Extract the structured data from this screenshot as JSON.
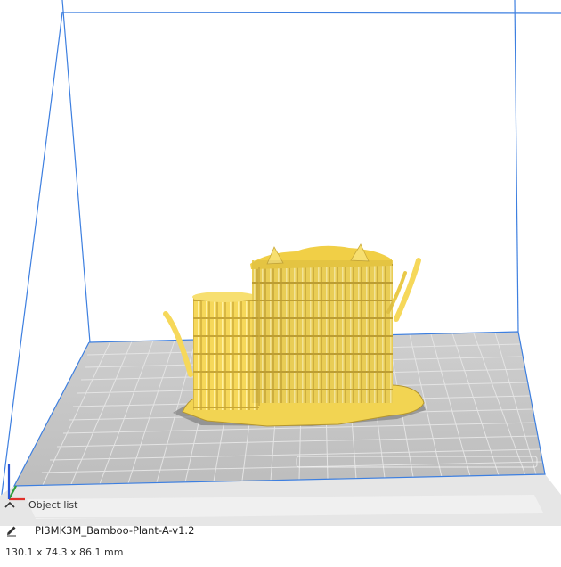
{
  "object_list": {
    "toggle_label": "Object list",
    "toggle_icon": "chevron-up-icon"
  },
  "object": {
    "name": "PI3MK3M_Bamboo-Plant-A-v1.2",
    "edit_icon": "pencil-icon",
    "dimensions": "130.1 x 74.3 x 86.1 mm"
  },
  "colors": {
    "model": "#f7d95a",
    "model_shadow": "#c9a93a",
    "build_outline": "#3d7fe0",
    "plate": "#c8c8c8",
    "grid": "#ffffff",
    "axis_x": "#e0302a",
    "axis_y": "#2e9e3a",
    "axis_z": "#2a55d6"
  }
}
